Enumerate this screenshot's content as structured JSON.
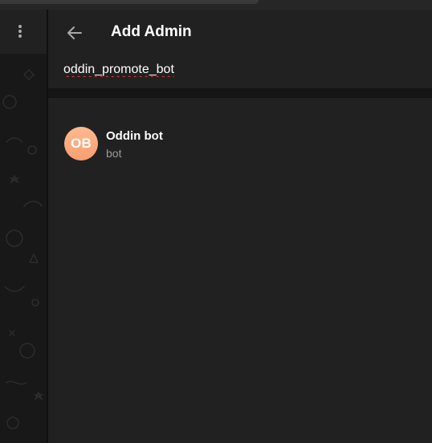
{
  "header": {
    "title": "Add Admin"
  },
  "search": {
    "value": "oddin_promote_bot"
  },
  "results": [
    {
      "initials": "OB",
      "name": "Oddin bot",
      "status": "bot"
    }
  ],
  "colors": {
    "panel_bg": "#212121",
    "separator": "#141414",
    "avatar_start": "#ffb98e",
    "avatar_end": "#f99e6f",
    "secondary_text": "#9a9a9a"
  },
  "icons": {
    "back": "arrow-left-icon",
    "menu": "more-vertical-icon"
  }
}
